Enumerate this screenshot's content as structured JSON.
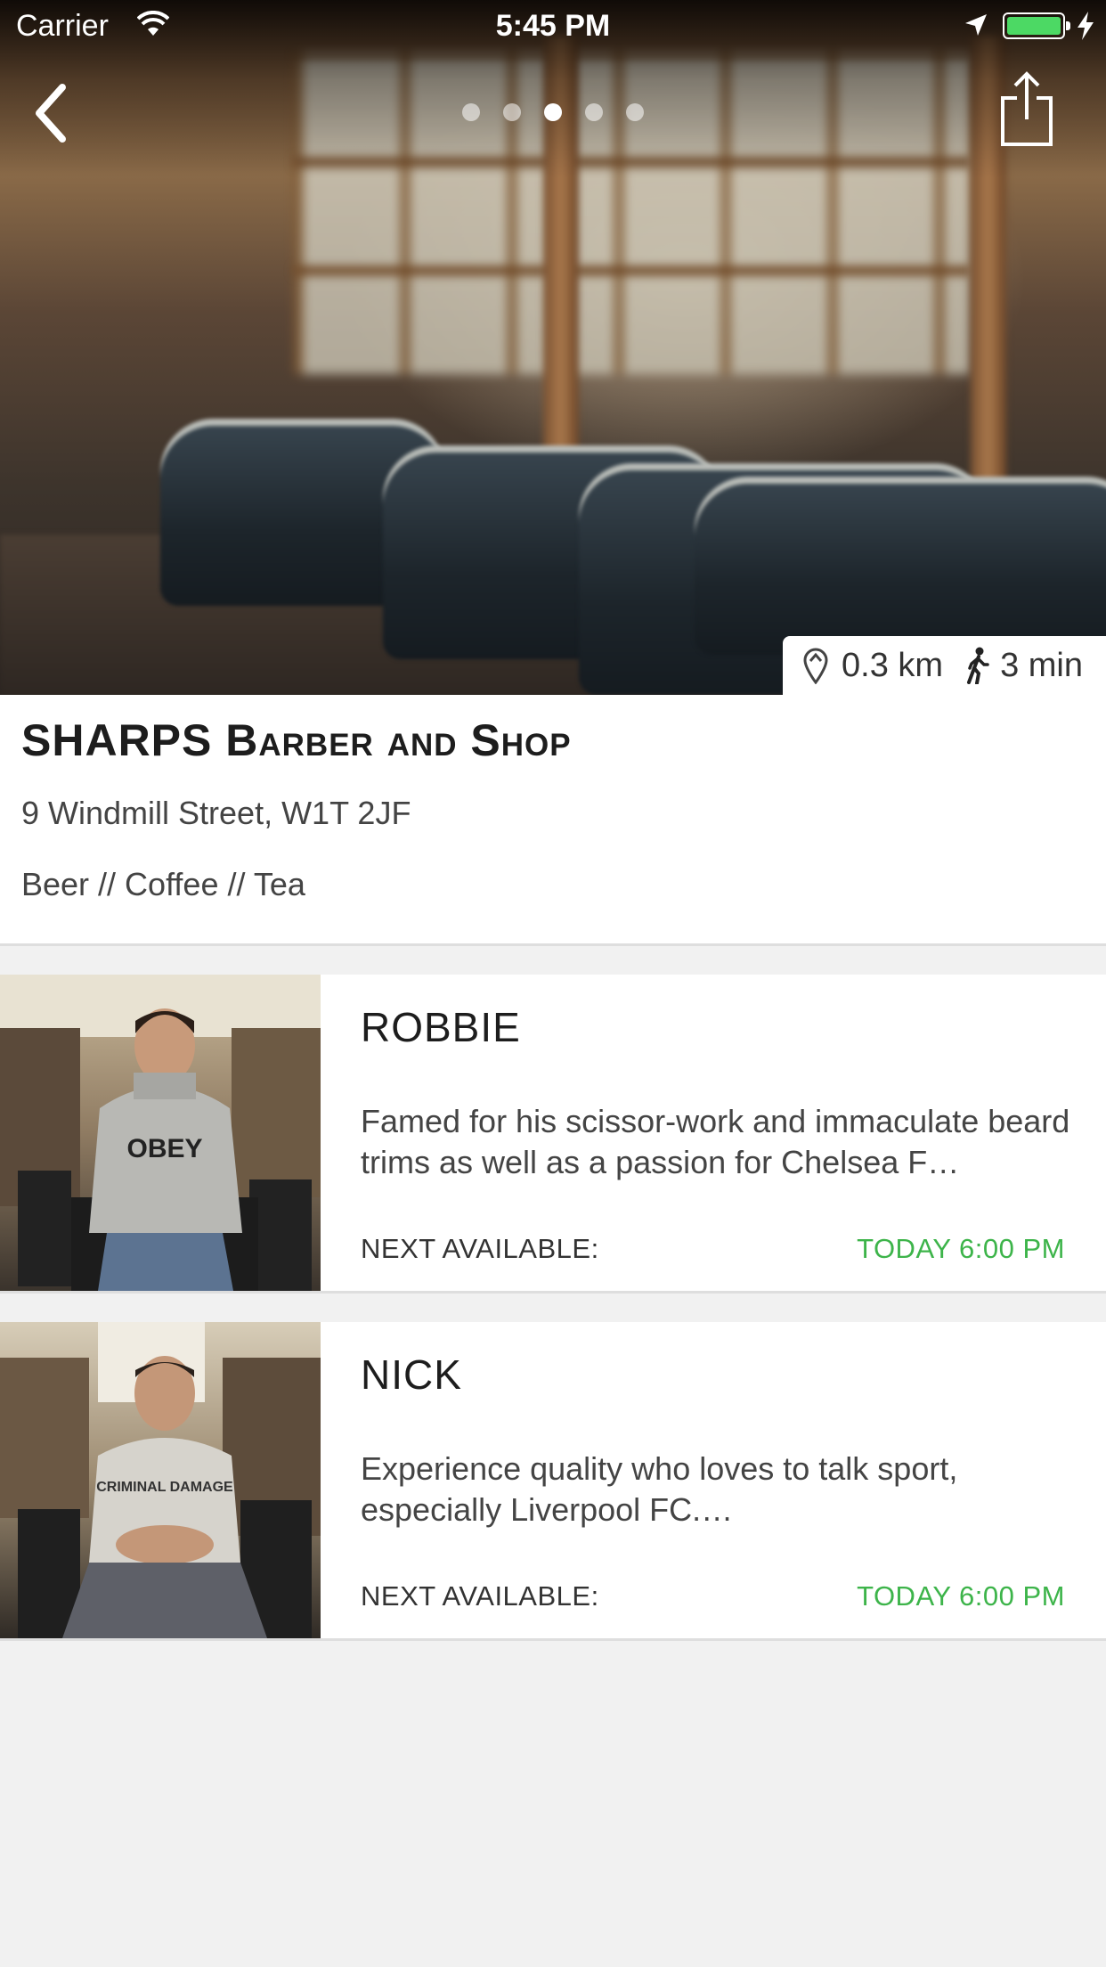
{
  "status_bar": {
    "carrier": "Carrier",
    "time": "5:45 PM"
  },
  "gallery": {
    "page_count": 5,
    "active_index": 2
  },
  "location": {
    "distance": "0.3 km",
    "walk_time": "3 min"
  },
  "shop": {
    "name": "SHARPS Barber and Shop",
    "address": "9 Windmill Street, W1T 2JF",
    "tags": "Beer // Coffee // Tea"
  },
  "barbers": [
    {
      "name": "ROBBIE",
      "bio": "Famed for his scissor-work and immaculate beard trims as well as a passion for Chelsea F…",
      "next_label": "NEXT AVAILABLE:",
      "next_time": "TODAY 6:00 PM",
      "shirt_text": "OBEY"
    },
    {
      "name": "NICK",
      "bio": "Experience quality who loves to talk sport, especially Liverpool FC.…",
      "next_label": "NEXT AVAILABLE:",
      "next_time": "TODAY 6:00 PM",
      "shirt_text": "CRIMINAL DAMAGE"
    }
  ],
  "colors": {
    "accent_green": "#3db44a",
    "battery_green": "#4cd964"
  }
}
